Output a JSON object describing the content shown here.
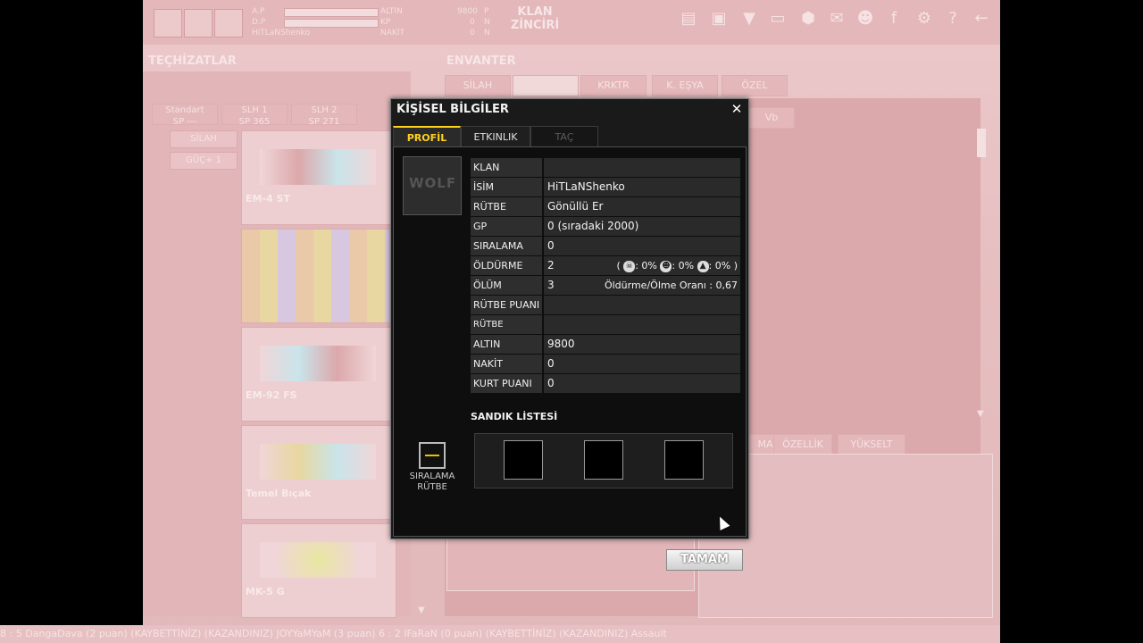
{
  "colors": {
    "accent_yellow": "#ffd21e",
    "dialog_bg": "#1a1a1a",
    "background_tint": "#e8c4c6"
  },
  "topbar": {
    "stat_labels_left": [
      "A.P",
      "D.P",
      "HiTLaNShenko"
    ],
    "stat_labels_right": [
      "ALTIN",
      "KP",
      "NAKİT"
    ],
    "stat_values": [
      "9800",
      "0",
      "0"
    ],
    "stat_suffix": [
      "P",
      "N",
      "N"
    ],
    "clan_chain": "KLAN ZİNCİRİ",
    "icons": [
      "cart-icon",
      "bag-icon",
      "wolf-icon",
      "book-icon",
      "cube-icon",
      "mail-icon",
      "profile-icon",
      "facebook-icon",
      "settings-icon",
      "help-icon",
      "back-icon"
    ]
  },
  "background": {
    "equipment_title": "TEÇHİZATLAR",
    "inventory_title": "ENVANTER",
    "inventory_tabs": [
      "SİLAH",
      "",
      "KRKTR",
      "K. EŞYA",
      "ÖZEL"
    ],
    "loadout_tabs": [
      "Standart",
      "SLH 1",
      "SLH 2"
    ],
    "loadout_sp": [
      "SP ---",
      "SP 365",
      "SP 271"
    ],
    "side_buttons": [
      "SİLAH",
      "GÜÇ+ 1"
    ],
    "weapons": [
      "EM-4 ST",
      "",
      "EM-92 FS",
      "Temel Bıçak",
      "MK-5 G"
    ],
    "vb_label": "Vb",
    "bottom_tabs": [
      "MA",
      "ÖZELLİK",
      "YÜKSELT"
    ],
    "ticker": "8 : 5 DangaDava (2 puan) (KAYBETTİNİZ)          (KAZANDINIZ) JOYYaMYaM (3 puan) 6 : 2 IFaRaN (0 puan) (KAYBETTİNİZ)          (KAZANDINIZ) Assault"
  },
  "dialog": {
    "title": "KİŞİSEL BİLGİLER",
    "tabs": [
      {
        "label": "PROFİL",
        "state": "active"
      },
      {
        "label": "ETKINLIK",
        "state": "normal"
      },
      {
        "label": "TAÇ",
        "state": "disabled"
      }
    ],
    "emblem_text": "WOLF",
    "rows": [
      {
        "label": "KLAN",
        "value": ""
      },
      {
        "label": "İSİM",
        "value": "HiTLaNShenko"
      },
      {
        "label": "RÜTBE",
        "value": "Gönüllü Er"
      },
      {
        "label": "GP",
        "value": "0 (sıradaki 2000)"
      },
      {
        "label": "SIRALAMA",
        "value": "0"
      },
      {
        "label": "ÖLDÜRME",
        "value": "2"
      },
      {
        "label": "ÖLÜM",
        "value": "3"
      },
      {
        "label": "RÜTBE PUANI",
        "value": ""
      },
      {
        "label": "RÜTBE SEVİYESİ",
        "value": ""
      },
      {
        "label": "ALTIN",
        "value": "9800"
      },
      {
        "label": "NAKİT",
        "value": "0"
      },
      {
        "label": "KURT PUANI",
        "value": "0"
      }
    ],
    "kill_stats": {
      "open": "(",
      "head": ": 0%",
      "face": ": 0%",
      "knife": ": 0%",
      "close": ")"
    },
    "kd_ratio": "Öldürme/Ölme Oranı : 0,67",
    "chest_list_title": "SANDIK LİSTESİ",
    "rank_label_line1": "SIRALAMA",
    "rank_label_line2": "RÜTBE",
    "ok_button": "TAMAM"
  }
}
